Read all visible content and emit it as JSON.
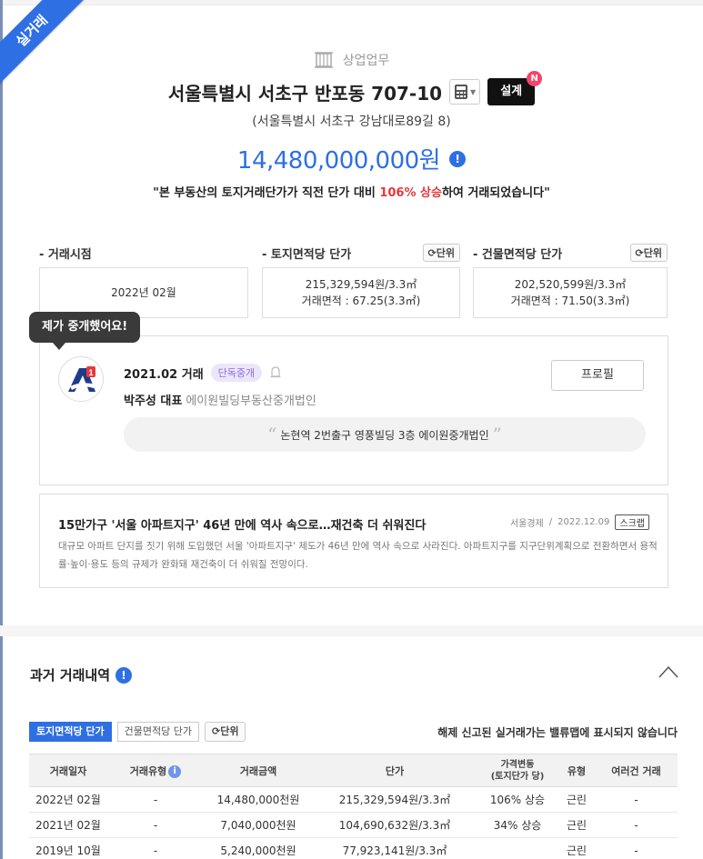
{
  "ribbon": "실거래",
  "header": {
    "category": "상업업무",
    "title": "서울특별시 서초구 반포동 707-10",
    "design_label": "설계",
    "design_badge": "N",
    "address": "(서울특별시 서초구 강남대로89길 8)",
    "price": "14,480,000,000원",
    "rise": {
      "prefix": "\"본 부동산의 토지거래단가가 직전 단가 대비 ",
      "highlight": "106% 상승",
      "suffix": "하여 거래되었습니다\""
    }
  },
  "stats": {
    "unit_label": "단위",
    "time": {
      "label": "- 거래시점",
      "value": "2022년 02월"
    },
    "land": {
      "label": "- 토지면적당 단가",
      "line1": "215,329,594원/3.3㎡",
      "line2": "거래면적 : 67.25(3.3㎡)"
    },
    "building": {
      "label": "- 건물면적당 단가",
      "line1": "202,520,599원/3.3㎡",
      "line2": "거래면적 : 71.50(3.3㎡)"
    }
  },
  "agent": {
    "tooltip": "제가 중개했어요!",
    "trade": "2021.02 거래",
    "pill": "단독중개",
    "name": "박주성 대표",
    "office": "에이원빌딩부동산중개법인",
    "profile_label": "프로필",
    "quote": "논현역 2번출구 영풍빌딩 3층 에이원중개법인"
  },
  "news": {
    "title": "15만가구 '서울 아파트지구' 46년 만에 역사 속으로…재건축 더 쉬워진다",
    "source": "서울경제",
    "date": "2022.12.09",
    "scrap": "스크랩",
    "body": "대규모 아파트 단지를 짓기 위해 도입했던 서울 '아파트지구' 제도가 46년 만에 역사 속으로 사라진다. 아파트지구를 지구단위계획으로 전환하면서 용적률·높이·용도 등의 규제가 완화돼 재건축이 더 쉬워질 전망이다."
  },
  "history": {
    "title": "과거 거래내역",
    "tabs": [
      "토지면적당 단가",
      "건물면적당 단가"
    ],
    "unit_label": "단위",
    "note": "해제 신고된 실거래가는 밸류맵에 표시되지 않습니다",
    "columns": {
      "date": "거래일자",
      "type": "거래유형",
      "amount": "거래금액",
      "unit_price": "단가",
      "change_line1": "가격변동",
      "change_line2": "(토지단가 당)",
      "kind": "유형",
      "multi": "여러건 거래"
    },
    "rows": [
      {
        "date": "2022년 02월",
        "type": "-",
        "amount": "14,480,000천원",
        "unit_price": "215,329,594원/3.3㎡",
        "change": "106% 상승",
        "kind": "근린",
        "multi": "-"
      },
      {
        "date": "2021년 02월",
        "type": "-",
        "amount": "7,040,000천원",
        "unit_price": "104,690,632원/3.3㎡",
        "change": "34% 상승",
        "kind": "근린",
        "multi": "-"
      },
      {
        "date": "2019년 10월",
        "type": "-",
        "amount": "5,240,000천원",
        "unit_price": "77,923,141원/3.3㎡",
        "change": "",
        "kind": "근린",
        "multi": "-"
      }
    ]
  },
  "colors": {
    "accent": "#2f6fe4",
    "rise": "#e5383b",
    "pill_bg": "#ece6fb"
  }
}
